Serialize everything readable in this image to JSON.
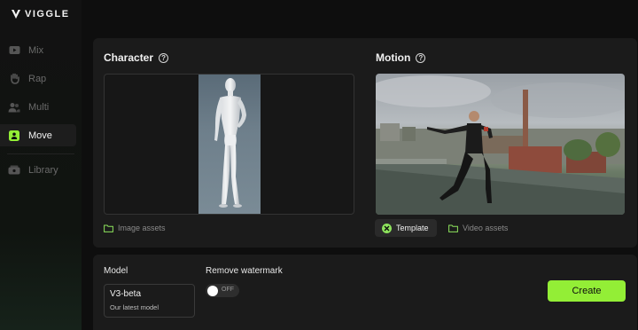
{
  "app": {
    "logo_text": "VIGGLE"
  },
  "sidebar": {
    "items": [
      {
        "label": "Mix",
        "icon": "video-icon",
        "active": false
      },
      {
        "label": "Rap",
        "icon": "hand-icon",
        "active": false
      },
      {
        "label": "Multi",
        "icon": "multi-user-icon",
        "active": false
      },
      {
        "label": "Move",
        "icon": "person-icon",
        "active": true
      },
      {
        "label": "Library",
        "icon": "library-icon",
        "active": false
      }
    ]
  },
  "character": {
    "title": "Character",
    "image_assets_label": "Image assets"
  },
  "motion": {
    "title": "Motion",
    "template_label": "Template",
    "video_assets_label": "Video assets"
  },
  "settings": {
    "model_label": "Model",
    "model_name": "V3-beta",
    "model_desc": "Our latest model",
    "watermark_label": "Remove watermark",
    "watermark_state": "OFF",
    "create_label": "Create"
  },
  "colors": {
    "accent": "#93ee36",
    "template_icon": "#8de35c",
    "background": "#0e0e0e",
    "panel": "#1b1b1b"
  }
}
